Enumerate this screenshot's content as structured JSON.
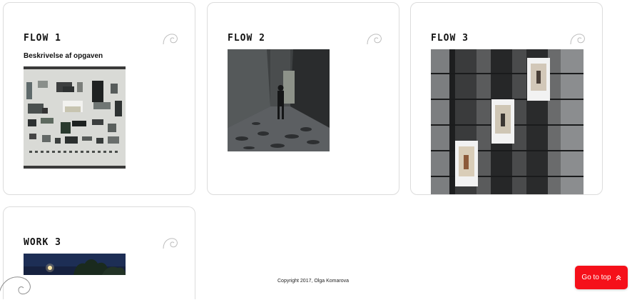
{
  "cards": [
    {
      "title": "FLOW 1",
      "subtitle": "Beskrivelse af opgaven",
      "icon": "spiral-icon",
      "image": "flatlay-objects-photo"
    },
    {
      "title": "FLOW 2",
      "icon": "spiral-icon",
      "image": "person-in-concrete-corridor-photo"
    },
    {
      "title": "FLOW 3",
      "icon": "spiral-icon",
      "image": "building-elevators-photo"
    },
    {
      "title": "WORK 3",
      "icon": "spiral-icon",
      "image": "night-trees-photo"
    }
  ],
  "footer": {
    "copyright": "Copyright 2017, Olga Komarova"
  },
  "go_top": {
    "label": "Go to top",
    "icon": "double-chevron-up-icon",
    "color": "#f5101a"
  },
  "colors": {
    "card_border": "#dcdcdc",
    "background": "#ffffff"
  }
}
